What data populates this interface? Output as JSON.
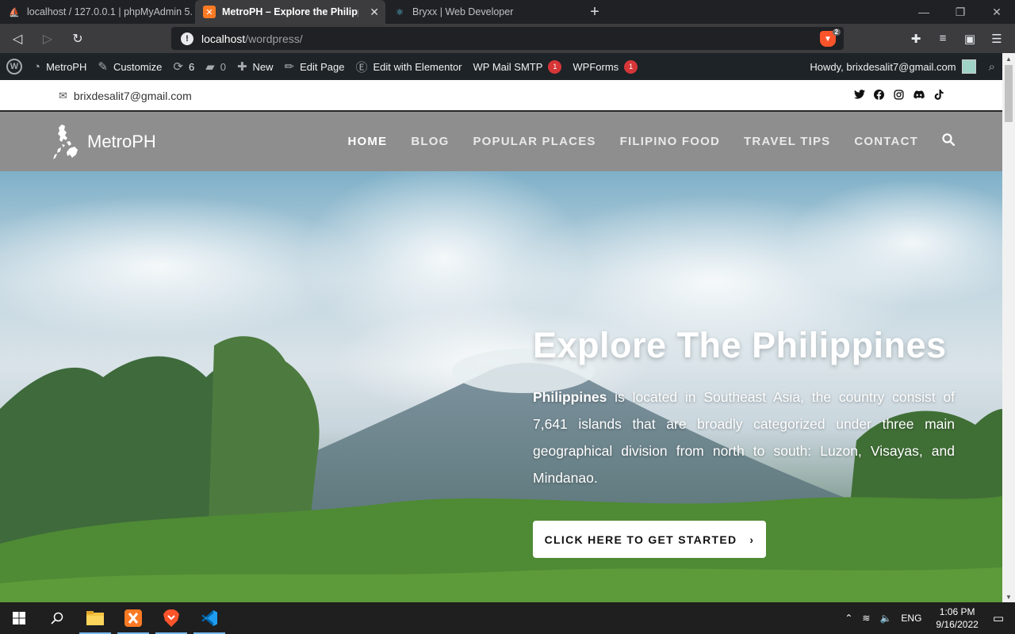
{
  "browser": {
    "tabs": [
      {
        "title": "localhost / 127.0.0.1 | phpMyAdmin 5.",
        "active": false
      },
      {
        "title": "MetroPH – Explore the Philippine",
        "active": true
      },
      {
        "title": "Bryxx | Web Developer",
        "active": false
      }
    ],
    "tab_close": "✕",
    "new_tab": "+",
    "address": {
      "host": "localhost",
      "path": "/wordpress/"
    },
    "shields_count": "2"
  },
  "admin_bar": {
    "site": "MetroPH",
    "customize": "Customize",
    "updates": "6",
    "comments": "0",
    "new": "New",
    "edit_page": "Edit Page",
    "elementor": "Edit with Elementor",
    "smtp": "WP Mail SMTP",
    "smtp_badge": "1",
    "wpforms": "WPForms",
    "wpforms_badge": "1",
    "howdy": "Howdy, brixdesalit7@gmail.com"
  },
  "topbar": {
    "email": "brixdesalit7@gmail.com",
    "social": [
      "twitter-icon",
      "facebook-icon",
      "instagram-icon",
      "discord-icon",
      "tiktok-icon"
    ]
  },
  "header": {
    "logo_text": "MetroPH",
    "nav": [
      "HOME",
      "BLOG",
      "POPULAR PLACES",
      "FILIPINO FOOD",
      "TRAVEL TIPS",
      "CONTACT"
    ],
    "active_nav": "HOME"
  },
  "hero": {
    "title": "Explore The Philippines",
    "text_bold": "Philippines",
    "text_rest": " is located in Southeast Asia, the country consist of 7,641 islands that are broadly categorized under three main geographical division from north to south: Luzon, Visayas, and Mindanao.",
    "cta": "CLICK HERE TO GET STARTED"
  },
  "taskbar": {
    "lang": "ENG",
    "time": "1:06 PM",
    "date": "9/16/2022"
  },
  "colors": {
    "admin_bar": "#1d2327",
    "badge": "#d63638",
    "header": "#8e8e8e",
    "browser_dark": "#202124"
  }
}
